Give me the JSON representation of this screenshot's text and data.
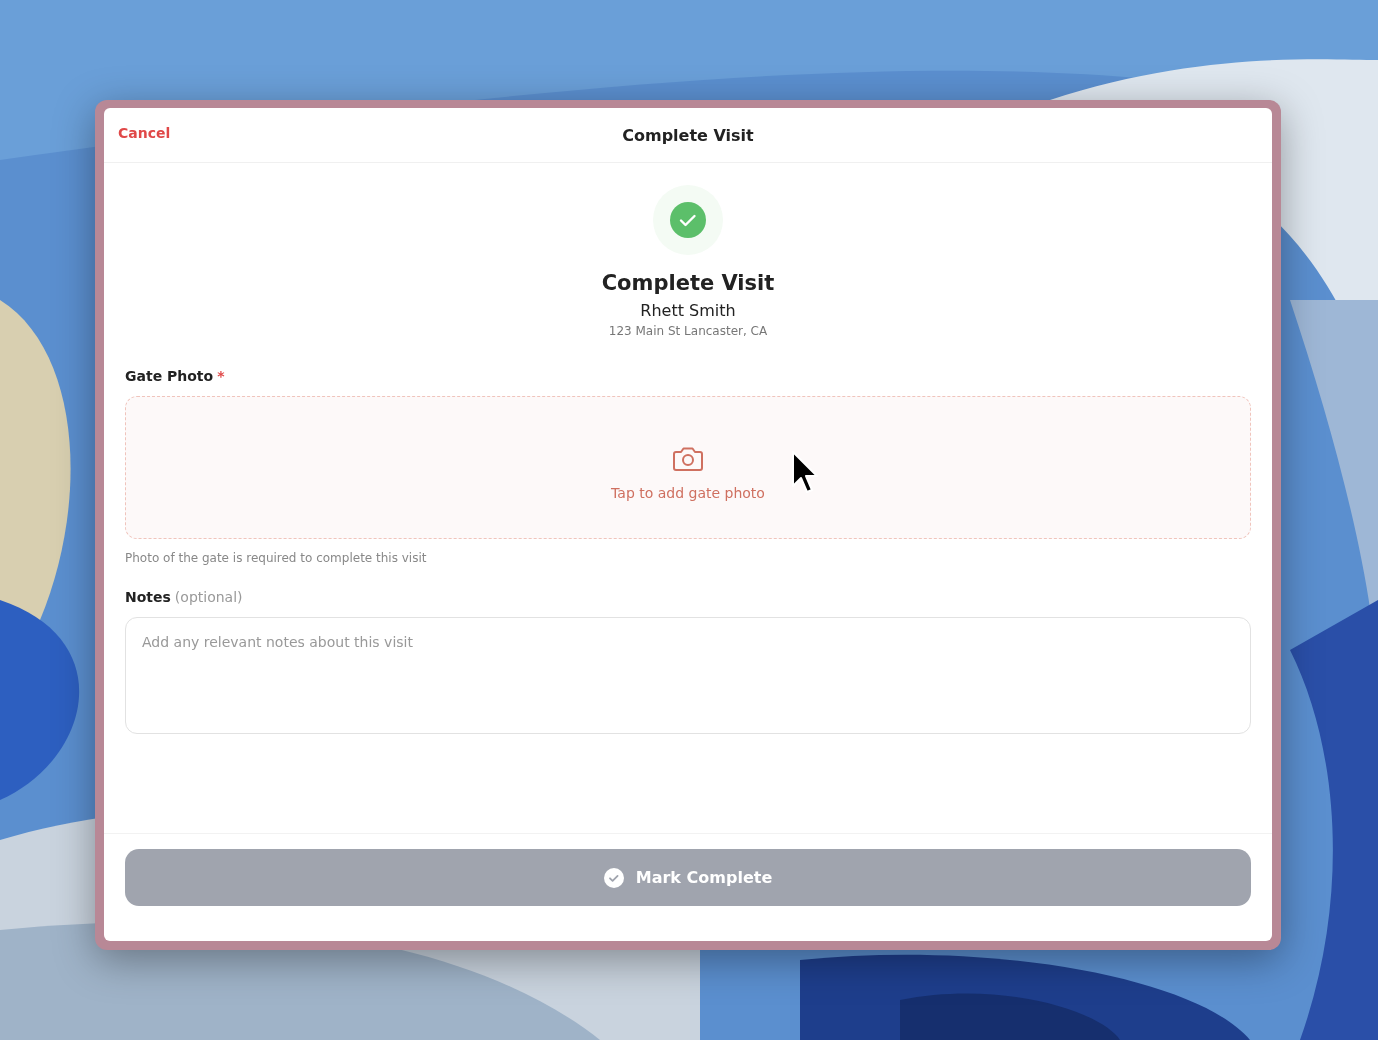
{
  "header": {
    "cancel": "Cancel",
    "title": "Complete Visit"
  },
  "summary": {
    "title": "Complete Visit",
    "name": "Rhett Smith",
    "address": "123 Main St Lancaster, CA"
  },
  "gate_photo": {
    "label": "Gate Photo",
    "required_mark": "*",
    "prompt": "Tap to add gate photo",
    "helper": "Photo of the gate is required to complete this visit"
  },
  "notes": {
    "label": "Notes",
    "qualifier": "(optional)",
    "placeholder": "Add any relevant notes about this visit"
  },
  "submit": {
    "label": "Mark Complete",
    "disabled": true
  }
}
